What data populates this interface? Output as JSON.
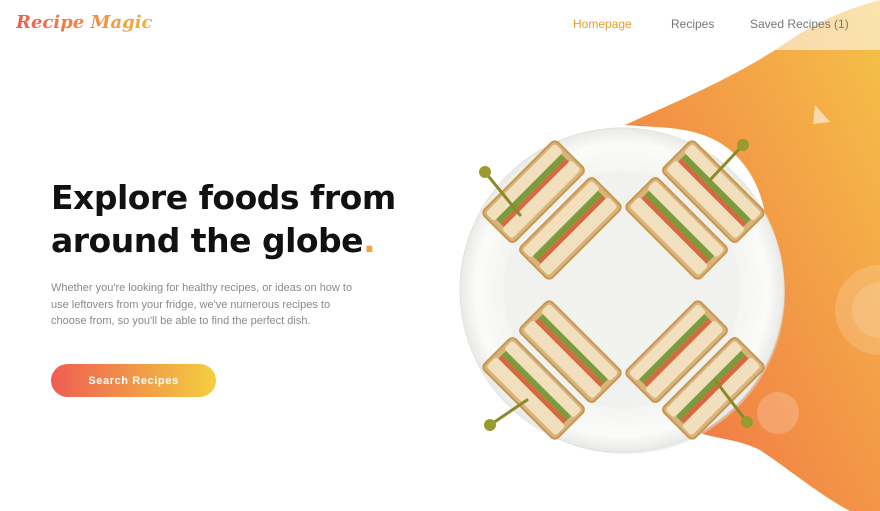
{
  "brand": {
    "name": "Recipe Magic"
  },
  "nav": {
    "items": [
      {
        "label": "Homepage",
        "active": true
      },
      {
        "label": "Recipes",
        "active": false
      },
      {
        "label": "Saved Recipes (1)",
        "active": false
      }
    ]
  },
  "hero": {
    "title_line1": "Explore foods from",
    "title_line2": "around the globe",
    "title_dot": ".",
    "description": "Whether you're looking for healthy recipes, or ideas on how to use leftovers from your fridge, we've numerous recipes to choose from, so you'll be able to find the perfect dish.",
    "cta_label": "Search Recipes"
  },
  "colors": {
    "accent": "#f2a33a",
    "gradient_start": "#ee5d52",
    "gradient_end": "#f4cf3f",
    "nav_active": "#e79d32"
  },
  "image": {
    "subject": "sandwich-plate"
  }
}
